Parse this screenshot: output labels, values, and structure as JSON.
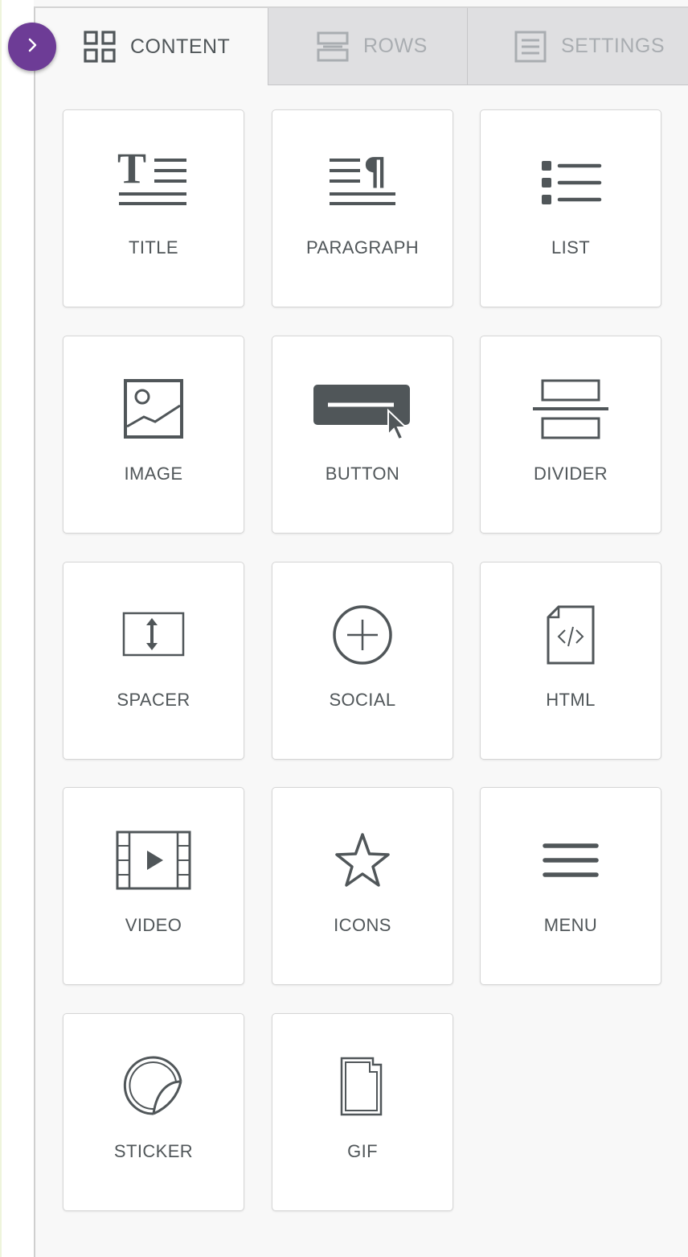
{
  "tabs": {
    "content": {
      "label": "CONTENT",
      "icon": "grid-icon",
      "active": true
    },
    "rows": {
      "label": "ROWS",
      "icon": "rows-icon",
      "active": false
    },
    "settings": {
      "label": "SETTINGS",
      "icon": "settings-icon",
      "active": false
    }
  },
  "toggle": {
    "icon": "chevron-right-icon",
    "color": "#6d3c96"
  },
  "tiles": [
    {
      "label": "TITLE",
      "icon": "title-icon"
    },
    {
      "label": "PARAGRAPH",
      "icon": "paragraph-icon"
    },
    {
      "label": "LIST",
      "icon": "list-icon"
    },
    {
      "label": "IMAGE",
      "icon": "image-icon"
    },
    {
      "label": "BUTTON",
      "icon": "button-icon"
    },
    {
      "label": "DIVIDER",
      "icon": "divider-icon"
    },
    {
      "label": "SPACER",
      "icon": "spacer-icon"
    },
    {
      "label": "SOCIAL",
      "icon": "social-icon"
    },
    {
      "label": "HTML",
      "icon": "html-icon"
    },
    {
      "label": "VIDEO",
      "icon": "video-icon"
    },
    {
      "label": "ICONS",
      "icon": "star-icon"
    },
    {
      "label": "MENU",
      "icon": "menu-icon"
    },
    {
      "label": "STICKER",
      "icon": "sticker-icon"
    },
    {
      "label": "GIF",
      "icon": "gif-icon"
    }
  ],
  "colors": {
    "accent": "#6d3c96",
    "icon": "#505659",
    "inactive_tab_text": "#a9adb1",
    "inactive_tab_bg": "#dfdfe1"
  }
}
